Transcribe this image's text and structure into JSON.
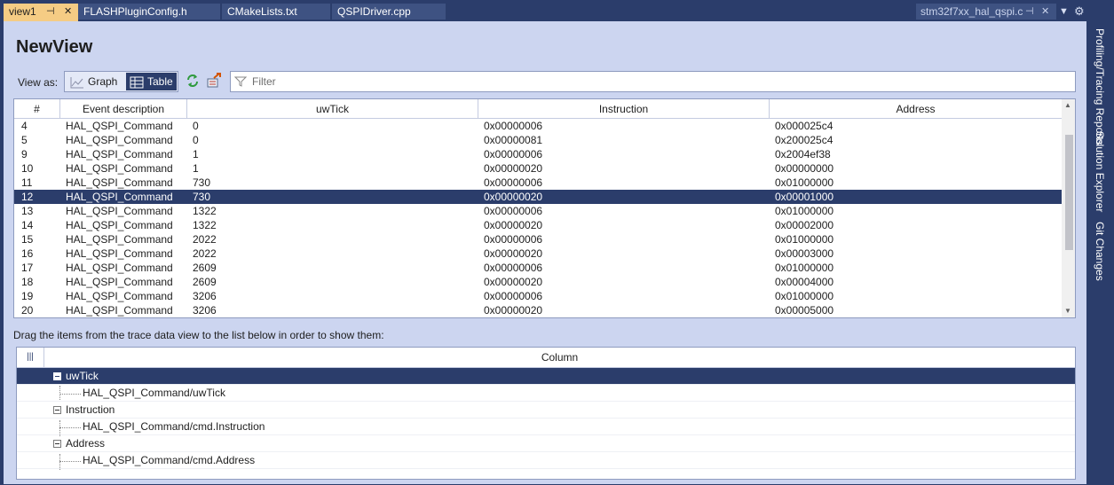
{
  "tabs": [
    {
      "label": "view1",
      "active": true
    },
    {
      "label": "FLASHPluginConfig.h",
      "active": false
    },
    {
      "label": "CMakeLists.txt",
      "active": false
    },
    {
      "label": "QSPIDriver.cpp",
      "active": false
    }
  ],
  "pinned_tab": {
    "label": "stm32f7xx_hal_qspi.c"
  },
  "view": {
    "title": "NewView",
    "view_as_label": "View as:",
    "graph_label": "Graph",
    "table_label": "Table",
    "selected_mode": "Table",
    "filter_placeholder": "Filter",
    "filter_value": ""
  },
  "grid": {
    "columns": [
      "#",
      "Event description",
      "uwTick",
      "Instruction",
      "Address"
    ],
    "rows": [
      [
        "4",
        "HAL_QSPI_Command",
        "0",
        "0x00000006",
        "0x000025c4"
      ],
      [
        "5",
        "HAL_QSPI_Command",
        "0",
        "0x00000081",
        "0x200025c4"
      ],
      [
        "9",
        "HAL_QSPI_Command",
        "1",
        "0x00000006",
        "0x2004ef38"
      ],
      [
        "10",
        "HAL_QSPI_Command",
        "1",
        "0x00000020",
        "0x00000000"
      ],
      [
        "11",
        "HAL_QSPI_Command",
        "730",
        "0x00000006",
        "0x01000000"
      ],
      [
        "12",
        "HAL_QSPI_Command",
        "730",
        "0x00000020",
        "0x00001000"
      ],
      [
        "13",
        "HAL_QSPI_Command",
        "1322",
        "0x00000006",
        "0x01000000"
      ],
      [
        "14",
        "HAL_QSPI_Command",
        "1322",
        "0x00000020",
        "0x00002000"
      ],
      [
        "15",
        "HAL_QSPI_Command",
        "2022",
        "0x00000006",
        "0x01000000"
      ],
      [
        "16",
        "HAL_QSPI_Command",
        "2022",
        "0x00000020",
        "0x00003000"
      ],
      [
        "17",
        "HAL_QSPI_Command",
        "2609",
        "0x00000006",
        "0x01000000"
      ],
      [
        "18",
        "HAL_QSPI_Command",
        "2609",
        "0x00000020",
        "0x00004000"
      ],
      [
        "19",
        "HAL_QSPI_Command",
        "3206",
        "0x00000006",
        "0x01000000"
      ],
      [
        "20",
        "HAL_QSPI_Command",
        "3206",
        "0x00000020",
        "0x00005000"
      ]
    ],
    "selected_row": "12"
  },
  "drag_hint": "Drag the items from the trace data view to the list below in order to show them:",
  "column_tree": {
    "header": "Column",
    "groups": [
      {
        "label": "uwTick",
        "child": "HAL_QSPI_Command/uwTick",
        "selected": true
      },
      {
        "label": "Instruction",
        "child": "HAL_QSPI_Command/cmd.Instruction",
        "selected": false
      },
      {
        "label": "Address",
        "child": "HAL_QSPI_Command/cmd.Address",
        "selected": false
      }
    ]
  },
  "side_tabs": [
    "Profiling/Tracing Reports",
    "Solution Explorer",
    "Git Changes"
  ],
  "colors": {
    "frame": "#2b3d6b",
    "panel": "#ccd5f0",
    "active_tab": "#f5cc84",
    "selection": "#2b3d6b"
  }
}
